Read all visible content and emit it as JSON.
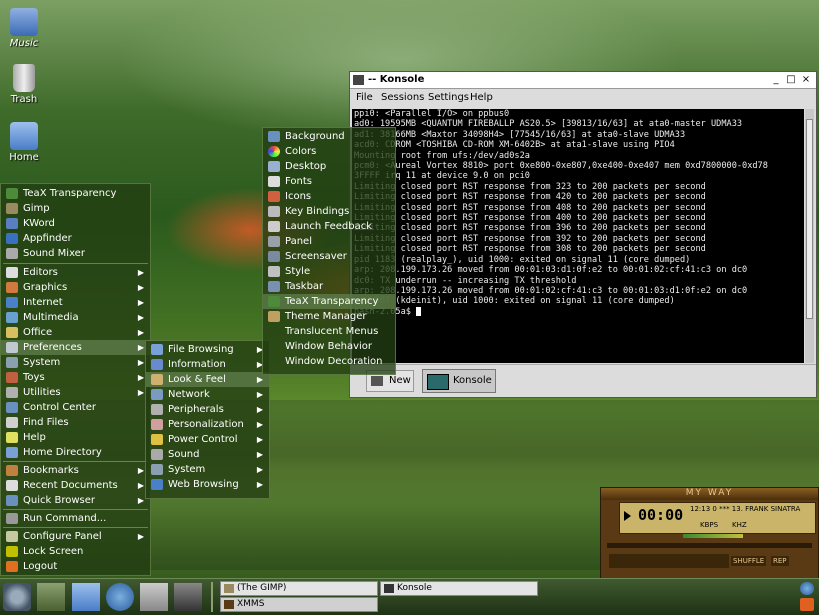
{
  "desktop": {
    "icons": [
      {
        "label": "Music"
      },
      {
        "label": "Trash"
      },
      {
        "label": "Home"
      }
    ]
  },
  "kmenu": {
    "top_items": [
      "TeaX Transparency",
      "Gimp",
      "KWord",
      "Appfinder",
      "Sound Mixer"
    ],
    "categories": [
      "Editors",
      "Graphics",
      "Internet",
      "Multimedia",
      "Office",
      "Preferences",
      "System",
      "Toys",
      "Utilities"
    ],
    "actions": [
      "Control Center",
      "Find Files",
      "Help",
      "Home Directory"
    ],
    "submenus": [
      "Bookmarks",
      "Recent Documents",
      "Quick Browser"
    ],
    "bottom": [
      "Run Command...",
      "Configure Panel",
      "Lock Screen",
      "Logout"
    ]
  },
  "preferences_menu": {
    "items": [
      "File Browsing",
      "Information",
      "Look & Feel",
      "Network",
      "Peripherals",
      "Personalization",
      "Power Control",
      "Sound",
      "System",
      "Web Browsing"
    ]
  },
  "lookfeel_menu": {
    "items": [
      "Background",
      "Colors",
      "Desktop",
      "Fonts",
      "Icons",
      "Key Bindings",
      "Launch Feedback",
      "Panel",
      "Screensaver",
      "Style",
      "Taskbar",
      "TeaX Transparency",
      "Theme Manager",
      "Translucent Menus",
      "Window Behavior",
      "Window Decoration"
    ]
  },
  "konsole": {
    "title": "-- Konsole",
    "menu": [
      "File",
      "Sessions",
      "Settings",
      "Help"
    ],
    "lines": [
      "ppi0: <Parallel I/O> on ppbus0",
      "ad0: 19595MB <QUANTUM FIREBALLP AS20.5> [39813/16/63] at ata0-master UDMA33",
      "ad1: 38166MB <Maxtor 34098H4> [77545/16/63] at ata0-slave UDMA33",
      "acd0: CDROM <TOSHIBA CD-ROM XM-6402B> at ata1-slave using PIO4",
      "Mounting root from ufs:/dev/ad0s2a",
      "pcm0: <Aureal Vortex 8810> port 0xe800-0xe807,0xe400-0xe407 mem 0xd7800000-0xd78",
      "3FFFF irq 11 at device 9.0 on pci0",
      "Limiting closed port RST response from 323 to 200 packets per second",
      "Limiting closed port RST response from 420 to 200 packets per second",
      "Limiting closed port RST response from 408 to 200 packets per second",
      "Limiting closed port RST response from 400 to 200 packets per second",
      "Limiting closed port RST response from 396 to 200 packets per second",
      "Limiting closed port RST response from 392 to 200 packets per second",
      "Limiting closed port RST response from 308 to 200 packets per second",
      "pid 1183 (realplay_), uid 1000: exited on signal 11 (core dumped)",
      "arp: 208.199.173.26 moved from 00:01:03:d1:0f:e2 to 00:01:02:cf:41:c3 on dc0",
      "dc0: TX underrun -- increasing TX threshold",
      "arp: 208.199.173.26 moved from 00:01:02:cf:41:c3 to 00:01:03:d1:0f:e2 on dc0",
      "pid 587 (kdeinit), uid 1000: exited on signal 11 (core dumped)",
      "bash-2.05a$ "
    ],
    "new_label": "New",
    "tab_label": "Konsole"
  },
  "xmms": {
    "title": "MY WAY",
    "time": "00:00",
    "track": "12:13  0  ***  13. FRANK SINATRA",
    "kbps": "KBPS",
    "khz": "KHZ",
    "shuffle": "SHUFFLE",
    "rep": "REP"
  },
  "taskbar": {
    "tasks": [
      "(The GIMP)",
      "Konsole",
      "XMMS"
    ]
  },
  "colors": {
    "menu_bg": "#223e12",
    "highlight": "#5a7846",
    "terminal_bg": "#000000"
  }
}
